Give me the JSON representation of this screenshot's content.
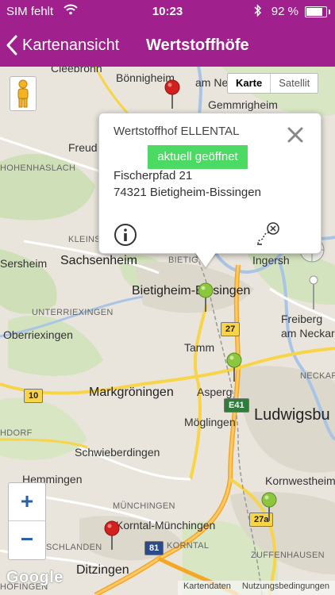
{
  "status_bar": {
    "carrier": "SIM fehlt",
    "time": "10:23",
    "battery": "92 %",
    "battery_level": 0.92
  },
  "nav": {
    "back_label": "Kartenansicht",
    "title": "Wertstoffhöfe"
  },
  "map": {
    "map_type": {
      "karte": "Karte",
      "satellite": "Satellit"
    },
    "places": {
      "cleebronn": "Cleebronn",
      "boennigheim": "Bönnigheim",
      "kirchheim": "am Ne",
      "gemmrigheim": "Gemmrigheim",
      "freud": "Freud",
      "hohenhaslach": "HOHENHASLACH",
      "kleins": "KLEINS",
      "sersheim": "Sersheim",
      "sachsenheim": "Sachsenheim",
      "bietig_small": "BIETIG",
      "ingersheim": "Ingersh",
      "bietigheim": "Bietigheim-Bissingen",
      "unterriexingen": "UNTERRIEXINGEN",
      "oberriexingen": "Oberriexingen",
      "tamm": "Tamm",
      "freiberg": "Freiberg",
      "neckar": "am Neckar",
      "neckar_small": "NECKAR",
      "markgroeningen": "Markgröningen",
      "asperg": "Asperg",
      "ludwigsburg": "Ludwigsbu",
      "moeglingen": "Möglingen",
      "hdorf": "HDORF",
      "schwieberdingen": "Schwieberdingen",
      "hemmingen": "Hemmingen",
      "kornwestheim": "Kornwestheim",
      "muenchingen": "MÜNCHINGEN",
      "korntal": "Korntal-Münchingen",
      "schlanden": "SCHLANDEN",
      "korntal_small": "KORNTAL",
      "zuffenhausen": "ZUFFENHAUSEN",
      "ditzingen": "Ditzingen",
      "hoefingen": "HÖFINGEN"
    },
    "shields": {
      "b27": "27",
      "b10": "10",
      "e41": "E41",
      "b27a": "27a",
      "a81": "81"
    },
    "zoom_in": "+",
    "zoom_out": "−",
    "google": "Google",
    "footer": {
      "kartendaten": "Kartendaten",
      "nutzung": "Nutzungsbedingungen"
    }
  },
  "popup": {
    "title": "Wertstoffhof ELLENTAL",
    "status": "aktuell geöffnet",
    "street": "Fischerpfad 21",
    "city": "74321 Bietigheim-Bissingen"
  },
  "colors": {
    "brand": "#a0208e",
    "open": "#4cd964",
    "marker_red": "#d2201e",
    "marker_green": "#8cc63f"
  }
}
